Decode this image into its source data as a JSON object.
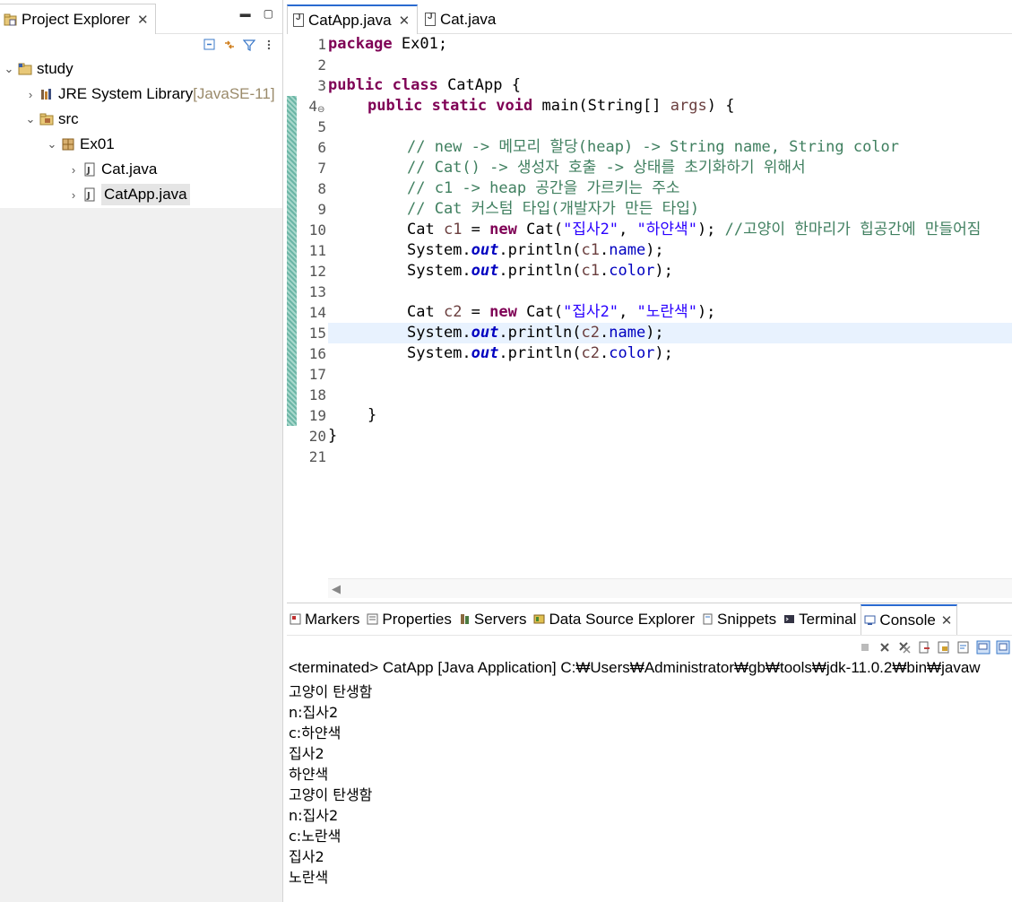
{
  "explorer": {
    "tab_title": "Project Explorer",
    "close_glyph": "✕",
    "minimize_glyph": "▬",
    "maximize_glyph": "▢",
    "tree": [
      {
        "label": "study",
        "suffix": "",
        "icon": "project-folder-icon"
      },
      {
        "label": "JRE System Library ",
        "suffix": "[JavaSE-11]",
        "icon": "library-icon"
      },
      {
        "label": "src",
        "suffix": "",
        "icon": "source-folder-icon"
      },
      {
        "label": "Ex01",
        "suffix": "",
        "icon": "package-icon"
      },
      {
        "label": "Cat.java",
        "suffix": "",
        "icon": "java-file-icon"
      },
      {
        "label": "CatApp.java",
        "suffix": "",
        "icon": "java-file-icon"
      }
    ]
  },
  "editor": {
    "tabs": [
      {
        "label": "CatApp.java",
        "active": true
      },
      {
        "label": "Cat.java",
        "active": false
      }
    ],
    "close_glyph": "✕",
    "line_numbers": [
      "1",
      "2",
      "3",
      "4",
      "5",
      "6",
      "7",
      "8",
      "9",
      "10",
      "11",
      "12",
      "13",
      "14",
      "15",
      "16",
      "17",
      "18",
      "19",
      "20",
      "21"
    ],
    "code": {
      "l1_kw": "package",
      "l1_rest": " Ex01;",
      "l3_kw": "public class",
      "l3_rest": " CatApp {",
      "l4_kw": "public static void",
      "l4_rest": " main(String[] ",
      "l4_var": "args",
      "l4_end": ") {",
      "l6": "// new -> 메모리 할당(heap) -> String name, String color",
      "l7": "// Cat() -> 생성자 호출 -> 상태를 초기화하기 위해서",
      "l8": "// c1 -> heap 공간을 가르키는 주소",
      "l9": "// Cat 커스텀 타입(개발자가 만든 타입)",
      "l10_a": "Cat ",
      "l10_var": "c1",
      "l10_b": " = ",
      "l10_kw": "new",
      "l10_c": " Cat(",
      "l10_s1": "\"집사2\"",
      "l10_d": ", ",
      "l10_s2": "\"하얀색\"",
      "l10_e": "); ",
      "l10_cmt": "//고양이 한마리가 힙공간에 만들어짐",
      "sys": "System.",
      "out": "out",
      "println": ".println(",
      "l11_var": "c1",
      "dot": ".",
      "name": "name",
      "color": "color",
      "close": ");",
      "l12_var": "c1",
      "l14_a": "Cat ",
      "l14_var": "c2",
      "l14_b": " = ",
      "l14_kw": "new",
      "l14_c": " Cat(",
      "l14_s1": "\"집사2\"",
      "l14_d": ", ",
      "l14_s2": "\"노란색\"",
      "l14_e": ");",
      "l15_var": "c2",
      "l16_var": "c2",
      "l19": "}",
      "l20": "}"
    }
  },
  "bottom": {
    "tabs": [
      {
        "label": "Markers",
        "icon": "markers-icon"
      },
      {
        "label": "Properties",
        "icon": "properties-icon"
      },
      {
        "label": "Servers",
        "icon": "servers-icon"
      },
      {
        "label": "Data Source Explorer",
        "icon": "data-source-icon"
      },
      {
        "label": "Snippets",
        "icon": "snippets-icon"
      },
      {
        "label": "Terminal",
        "icon": "terminal-icon"
      },
      {
        "label": "Console",
        "icon": "console-icon"
      }
    ],
    "close_glyph": "✕",
    "status": "<terminated> CatApp [Java Application] C:₩Users₩Administrator₩gb₩tools₩jdk-11.0.2₩bin₩javaw",
    "output": [
      "고양이 탄생함",
      "n:집사2",
      "c:하얀색",
      "집사2",
      "하얀색",
      "고양이 탄생함",
      "n:집사2",
      "c:노란색",
      "집사2",
      "노란색"
    ]
  },
  "colors": {
    "keyword": "#7f0055",
    "string": "#2a00ff",
    "comment": "#3f7f5f",
    "field": "#0000c0",
    "local_var": "#6a3e3e",
    "active_tab": "#2a6ad0",
    "current_line": "#e8f2fe"
  }
}
